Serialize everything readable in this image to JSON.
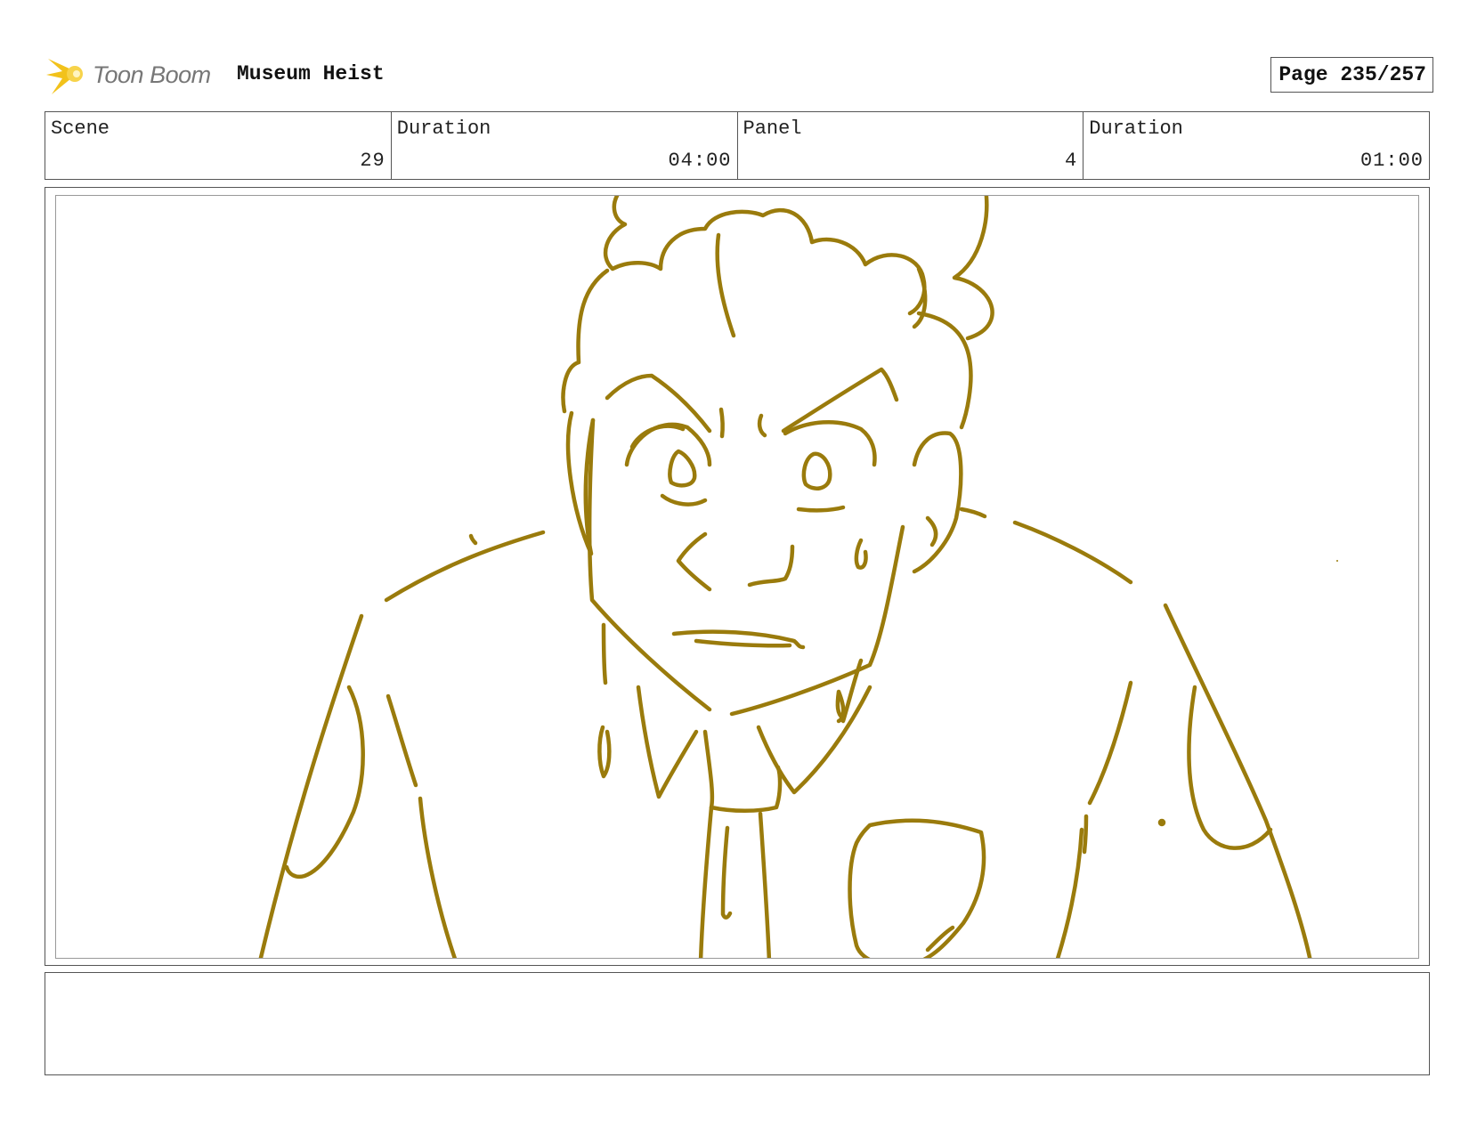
{
  "header": {
    "logo_text": "Toon Boom",
    "project_title": "Museum Heist",
    "page_label": "Page 235/257"
  },
  "info": {
    "scene_label": "Scene",
    "scene_value": "29",
    "scene_duration_label": "Duration",
    "scene_duration_value": "04:00",
    "panel_label": "Panel",
    "panel_value": "4",
    "panel_duration_label": "Duration",
    "panel_duration_value": "01:00"
  },
  "colors": {
    "sketch_line": "#9a7b0c",
    "logo_flare": "#f2c21b"
  },
  "notes": {
    "text": ""
  }
}
